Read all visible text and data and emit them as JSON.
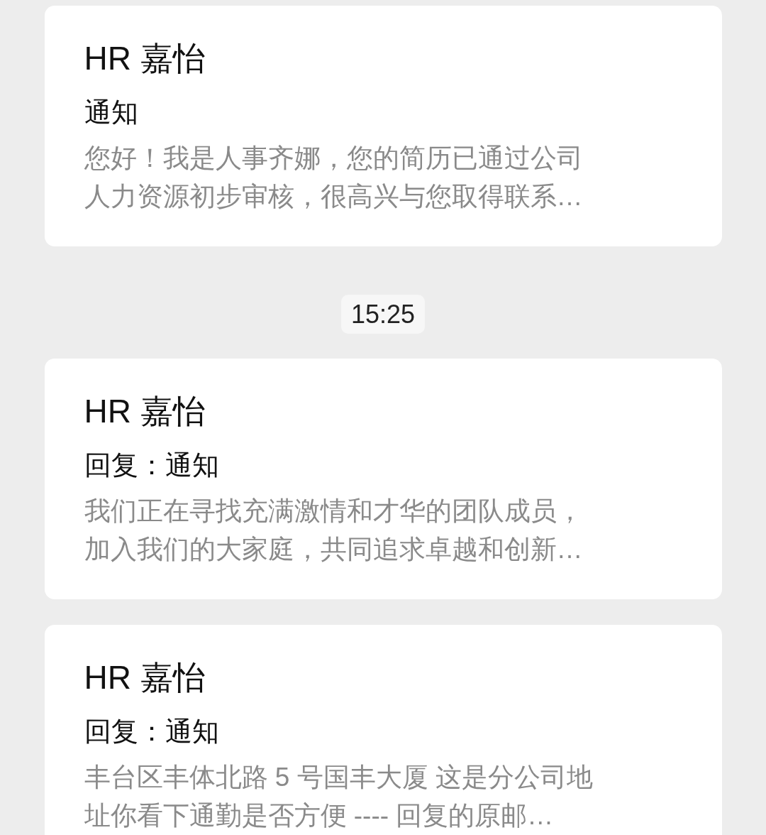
{
  "messages": [
    {
      "kind": "card",
      "sender": "HR 嘉怡",
      "subject": "通知",
      "preview_lines": [
        "您好！我是人事齐娜，您的简历已通过公司",
        "人力资源初步审核，很高兴与您取得联系…"
      ]
    },
    {
      "kind": "time",
      "text": "15:25"
    },
    {
      "kind": "card",
      "sender": "HR 嘉怡",
      "subject": "回复：通知",
      "preview_lines": [
        "我们正在寻找充满激情和才华的团队成员，",
        "加入我们的大家庭，共同追求卓越和创新…"
      ]
    },
    {
      "kind": "card",
      "sender": "HR 嘉怡",
      "subject": "回复：通知",
      "preview_lines": [
        "丰台区丰体北路 5 号国丰大厦 这是分公司地",
        "址你看下通勤是否方便  ---- 回复的原邮…"
      ]
    }
  ]
}
